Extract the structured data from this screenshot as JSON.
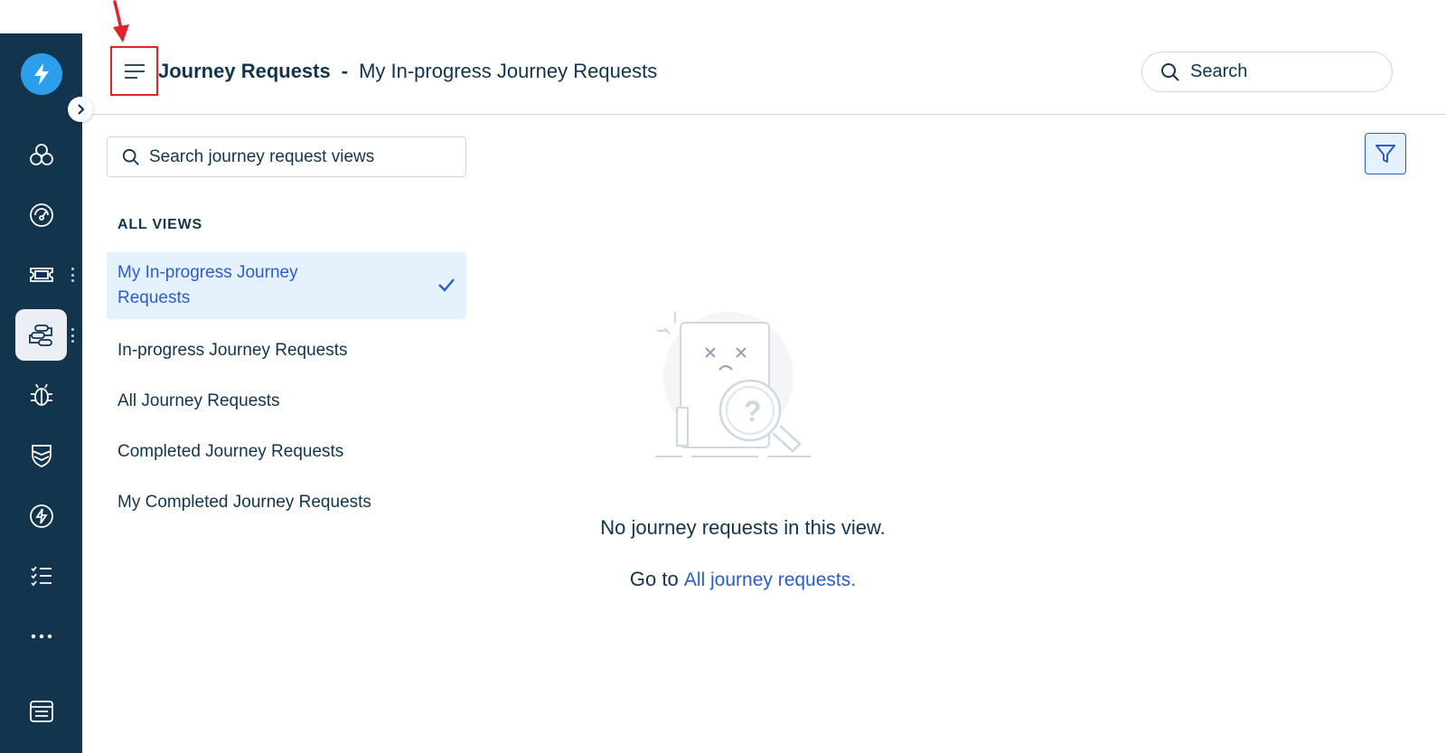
{
  "header": {
    "title": "Journey Requests",
    "separator": "-",
    "subtitle": "My In-progress Journey Requests",
    "search_label": "Search"
  },
  "rail": {
    "items": [
      {
        "icon": "apps-icon"
      },
      {
        "icon": "dashboard-icon"
      },
      {
        "icon": "tickets-icon"
      },
      {
        "icon": "journeys-icon",
        "active": true
      },
      {
        "icon": "problems-icon"
      },
      {
        "icon": "changes-icon"
      },
      {
        "icon": "releases-icon"
      },
      {
        "icon": "tasks-icon"
      },
      {
        "icon": "more-icon"
      },
      {
        "icon": "reports-icon"
      }
    ]
  },
  "views_panel": {
    "search_placeholder": "Search journey request views",
    "heading": "ALL VIEWS",
    "items": [
      {
        "label": "My In-progress Journey Requests",
        "selected": true
      },
      {
        "label": "In-progress Journey Requests"
      },
      {
        "label": "All Journey Requests"
      },
      {
        "label": "Completed Journey Requests"
      },
      {
        "label": "My Completed Journey Requests"
      }
    ]
  },
  "empty_state": {
    "message": "No journey requests in this view.",
    "goto_prefix": "Go to",
    "goto_link": "All journey requests."
  },
  "colors": {
    "rail_bg": "#12344d",
    "accent": "#2c5cc5",
    "logo": "#2c9eea",
    "selected_bg": "#e5f2fd",
    "highlight": "#e0242c"
  }
}
